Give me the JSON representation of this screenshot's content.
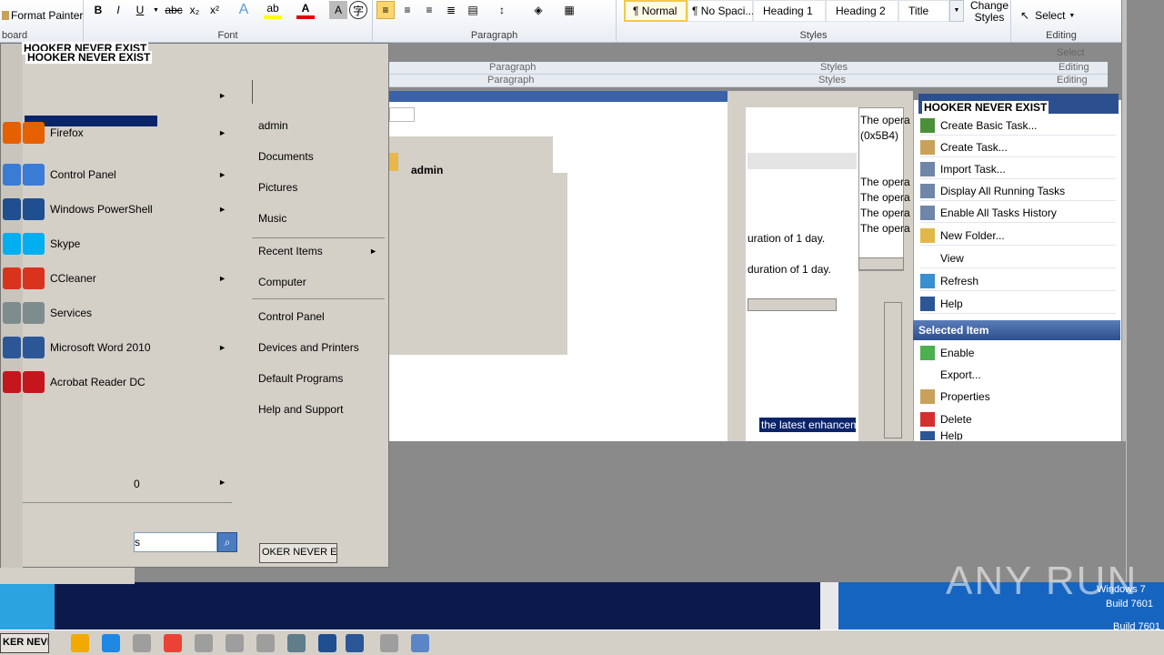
{
  "ribbon": {
    "format_painter": "Format Painter",
    "clipboard_label": "board",
    "font_label": "Font",
    "paragraph_label": "Paragraph",
    "styles_label": "Styles",
    "editing_label": "Editing",
    "bold": "B",
    "italic": "I",
    "underline": "U",
    "strike": "abc",
    "subscript": "x₂",
    "superscript": "x²",
    "styles": [
      "¶ Normal",
      "¶ No Spaci...",
      "Heading 1",
      "Heading 2",
      "Title"
    ],
    "change_styles": "Change Styles",
    "select": "Select",
    "ghost_paragraph": "Paragraph",
    "ghost_styles": "Styles",
    "ghost_editing": "Editing",
    "ghost_select": "Select"
  },
  "banner": {
    "line1": "HOOKER NEVER EXIST",
    "line2": "HOOKER NEVER EXIST"
  },
  "start_menu": {
    "programs": [
      {
        "label": "Firefox",
        "arrow": true,
        "color": "#e66000"
      },
      {
        "label": "Control Panel",
        "arrow": true,
        "color": "#3a7bd5"
      },
      {
        "label": "Windows PowerShell",
        "arrow": true,
        "color": "#1f4f91"
      },
      {
        "label": "Skype",
        "arrow": false,
        "color": "#00aff0"
      },
      {
        "label": "CCleaner",
        "arrow": true,
        "color": "#d9331e"
      },
      {
        "label": "Services",
        "arrow": false,
        "color": "#7f8c8d"
      },
      {
        "label": "Microsoft Word 2010",
        "arrow": true,
        "color": "#2b5797"
      },
      {
        "label": "Acrobat Reader DC",
        "arrow": false,
        "color": "#c4161c"
      }
    ],
    "all_programs_tail": "0",
    "search_tail": "s",
    "right_items": [
      "admin",
      "Documents",
      "Pictures",
      "Music",
      "Recent Items",
      "Computer",
      "Control Panel",
      "Devices and Printers",
      "Default Programs",
      "Help and Support"
    ],
    "shutdown_label": "OKER NEVER EXIS"
  },
  "explorer": {
    "user": "admin"
  },
  "history": {
    "op1": "The opera",
    "code": "(0x5B4)",
    "op_rows": [
      "The opera",
      "The opera",
      "The opera",
      "The opera"
    ],
    "duration1": "uration of 1 day.",
    "duration2": "duration of 1 day.",
    "highlight": "the latest enhancem"
  },
  "actions": {
    "header_line": "HOOKER NEVER EXIST",
    "items": [
      "Create Basic Task...",
      "Create Task...",
      "Import Task...",
      "Display All Running Tasks",
      "Enable All Tasks History",
      "New Folder...",
      "View",
      "Refresh",
      "Help"
    ],
    "selected_header": "Selected Item",
    "selected_items": [
      "Enable",
      "Export...",
      "Properties",
      "Delete",
      "Help"
    ]
  },
  "watermark": {
    "text": "ANY RUN"
  },
  "os": {
    "line1": "Windows 7",
    "line2": "Build 7601",
    "line3": "Build 7601"
  },
  "taskbar": {
    "start_label": "KER NEVE"
  }
}
